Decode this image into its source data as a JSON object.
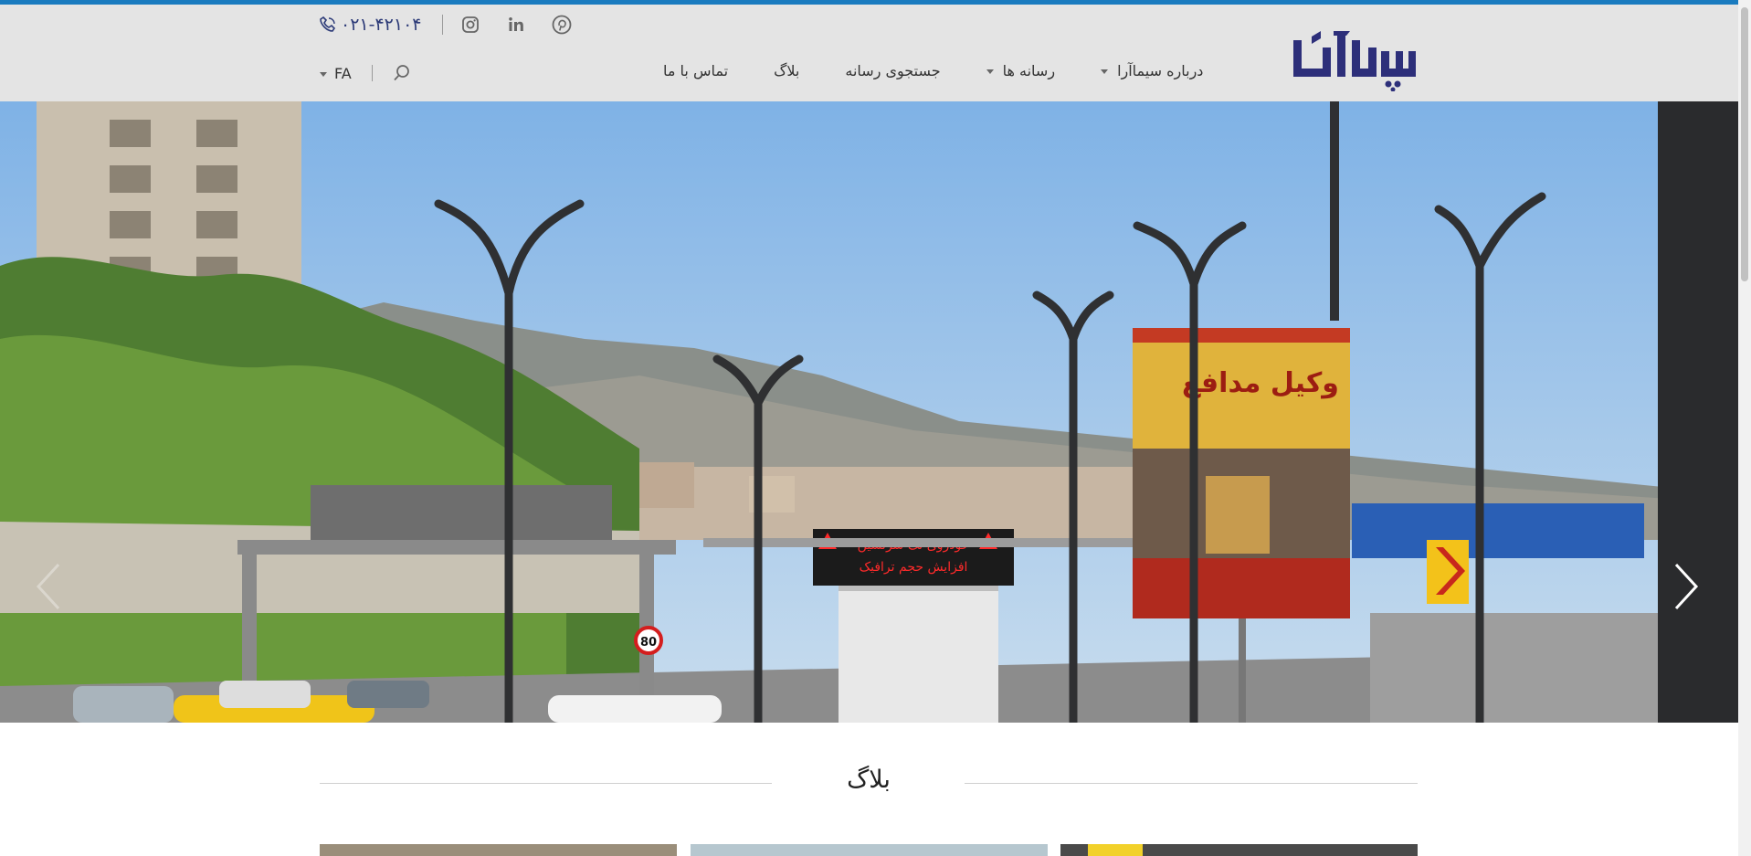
{
  "brand": {
    "logo_alt": "سیماآرا",
    "color": "#2d2f7a"
  },
  "contact": {
    "phone": "۰۲۱-۴۲۱۰۴",
    "social": [
      {
        "name": "pinterest-icon"
      },
      {
        "name": "linkedin-icon"
      },
      {
        "name": "instagram-icon"
      }
    ]
  },
  "language": {
    "label": "FA"
  },
  "nav": {
    "items": [
      {
        "label": "درباره سیماآرا",
        "has_dropdown": true
      },
      {
        "label": "رسانه ها",
        "has_dropdown": true
      },
      {
        "label": "جستجوی رسانه",
        "has_dropdown": false
      },
      {
        "label": "بلاگ",
        "has_dropdown": false
      },
      {
        "label": "تماس با ما",
        "has_dropdown": false
      }
    ]
  },
  "hero": {
    "vms_line1": "خودروی تک سرنشین",
    "vms_line2": "افزایش حجم ترافیک",
    "billboard_title": "وکیل مدافع",
    "sign_speed": "80"
  },
  "section": {
    "title": "بلاگ"
  },
  "colors": {
    "accent": "#1a7bbf",
    "header_bg": "#e4e4e4",
    "nav_text": "#333333",
    "brand": "#2d2f7a"
  }
}
